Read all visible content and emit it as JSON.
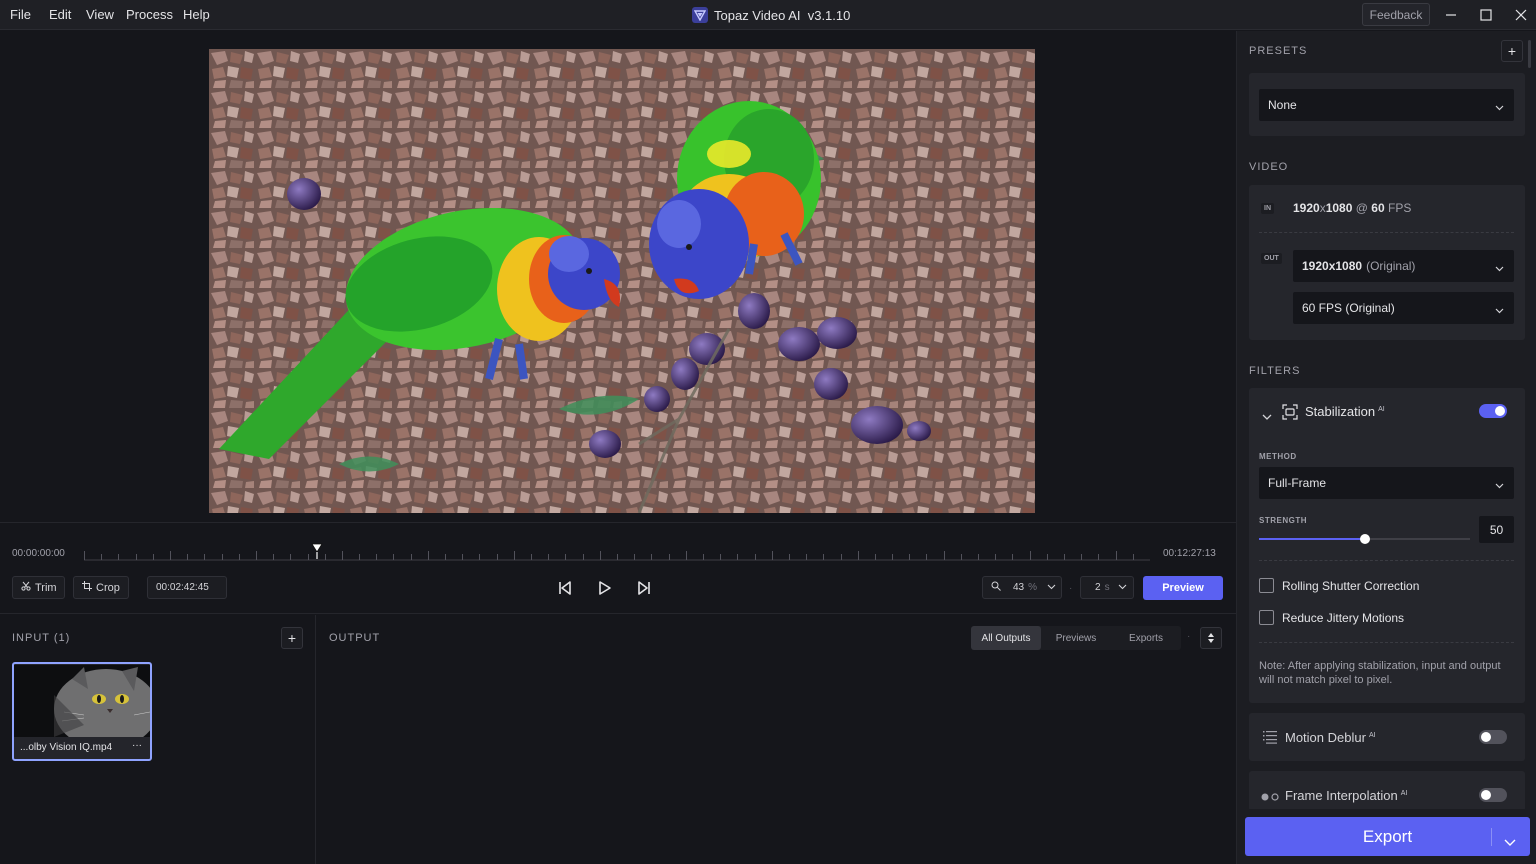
{
  "menu": [
    "File",
    "Edit",
    "View",
    "Process",
    "Help"
  ],
  "app_title": "Topaz Video AI  v3.1.10",
  "feedback_label": "Feedback",
  "timeline": {
    "start_time": "00:00:00:00",
    "end_time": "00:12:27:13",
    "playhead_fraction": 0.219,
    "trim_label": "Trim",
    "crop_label": "Crop",
    "current_time": "00:02:42:45",
    "zoom_value": "43",
    "zoom_unit": "%",
    "interval_value": "2",
    "interval_unit": "s",
    "preview_label": "Preview"
  },
  "input": {
    "header": "INPUT (1)",
    "file_name": "...olby Vision IQ.mp4",
    "more": "···"
  },
  "output": {
    "header": "OUTPUT",
    "tabs": [
      "All Outputs",
      "Previews",
      "Exports"
    ],
    "active_tab": "All Outputs"
  },
  "right_panel": {
    "presets_label": "PRESETS",
    "preset_value": "None",
    "video_label": "VIDEO",
    "in_tag": "IN",
    "in_res_w": "1920",
    "in_res_x": "x",
    "in_res_h": "1080",
    "in_at": "@",
    "in_fps": "60",
    "in_fps_unit": "FPS",
    "out_tag": "OUT",
    "out_res_bold": "1920x1080",
    "out_res_note": "(Original)",
    "out_fps": "60 FPS (Original)",
    "filters_label": "FILTERS",
    "stabilization": {
      "name": "Stabilization",
      "ai": "AI",
      "enabled": true,
      "method_label": "METHOD",
      "method_value": "Full-Frame",
      "strength_label": "STRENGTH",
      "strength_value": "50",
      "strength_fraction": 0.5,
      "rolling_shutter": "Rolling Shutter Correction",
      "reduce_jitter": "Reduce Jittery Motions",
      "note": "Note: After applying stabilization, input and output will not match pixel to pixel."
    },
    "motion_deblur": {
      "name": "Motion Deblur",
      "ai": "AI",
      "enabled": false
    },
    "frame_interpolation": {
      "name": "Frame Interpolation",
      "ai": "AI",
      "enabled": false
    },
    "export_label": "Export"
  },
  "colors": {
    "accent": "#5b61f2",
    "toggle_on": "#5b61f2",
    "toggle_off": "#52525b"
  }
}
